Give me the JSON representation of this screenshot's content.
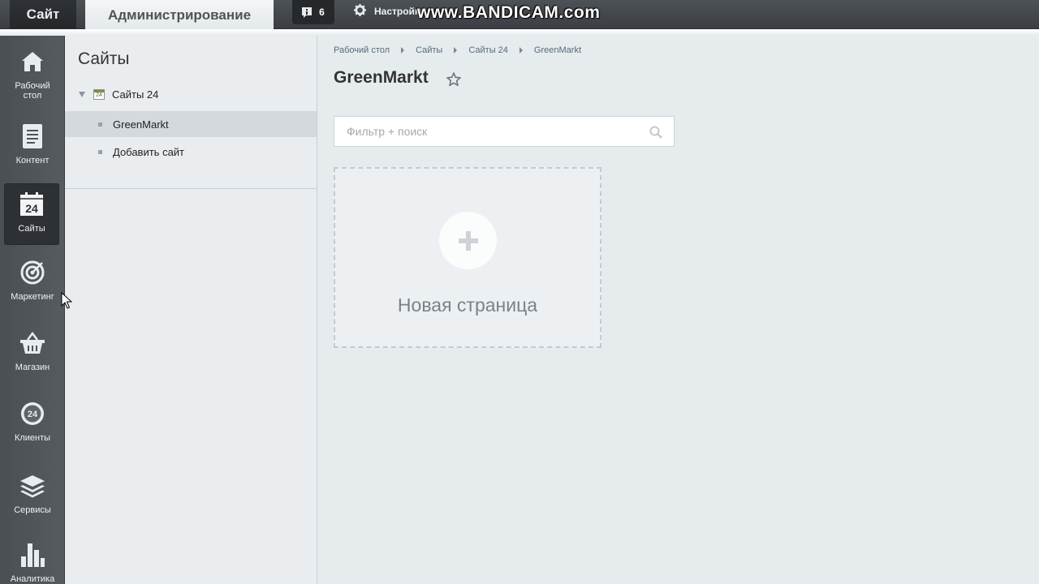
{
  "topbar": {
    "site_tab": "Сайт",
    "admin_tab": "Администрирование",
    "notifications_count": "6",
    "settings_label": "Настройки",
    "watermark": "www.BANDICAM.com"
  },
  "leftnav": {
    "items": [
      {
        "label": "Рабочий стол",
        "icon": "home-icon"
      },
      {
        "label": "Контент",
        "icon": "document-icon"
      },
      {
        "label": "Сайты",
        "icon": "sites-24-icon",
        "active": true
      },
      {
        "label": "Маркетинг",
        "icon": "target-icon"
      },
      {
        "label": "Магазин",
        "icon": "basket-icon"
      },
      {
        "label": "Клиенты",
        "icon": "clients-24-icon"
      },
      {
        "label": "Сервисы",
        "icon": "layers-icon"
      },
      {
        "label": "Аналитика",
        "icon": "bar-chart-icon"
      }
    ]
  },
  "sidebar": {
    "title": "Сайты",
    "tree_root": "Сайты 24",
    "tree_root_badge": "24",
    "items": [
      {
        "label": "GreenMarkt",
        "selected": true
      },
      {
        "label": "Добавить сайт",
        "selected": false
      }
    ]
  },
  "breadcrumb": [
    "Рабочий стол",
    "Сайты",
    "Сайты 24",
    "GreenMarkt"
  ],
  "main": {
    "title": "GreenMarkt",
    "search_placeholder": "Фильтр + поиск",
    "new_page_label": "Новая страница"
  },
  "colors": {
    "topbar": "#3f4348",
    "leftnav": "#4f5459",
    "background": "#e6ebee",
    "link": "#546b7c"
  }
}
